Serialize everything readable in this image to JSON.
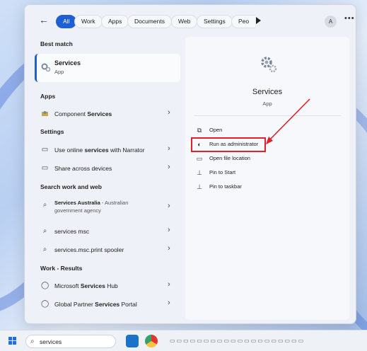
{
  "filters": {
    "back": "←",
    "chips": [
      "All",
      "Work",
      "Apps",
      "Documents",
      "Web",
      "Settings",
      "Peo"
    ],
    "avatar": "A",
    "more": "•••"
  },
  "left": {
    "best_match": {
      "section": "Best match",
      "title": "Services",
      "subtitle": "App"
    },
    "apps": {
      "section": "Apps",
      "items": [
        {
          "pre": "Component ",
          "bold": "Services"
        }
      ]
    },
    "settings": {
      "section": "Settings",
      "items": [
        {
          "pre": "Use online ",
          "bold": "services",
          "post": " with Narrator"
        },
        {
          "pre": "Share across devices"
        }
      ]
    },
    "web": {
      "section": "Search work and web",
      "items": [
        {
          "bold": "Services Australia",
          "post": " - Australian government agency"
        },
        {
          "pre": "services msc"
        },
        {
          "pre": "services.msc.print spooler"
        }
      ]
    },
    "work": {
      "section": "Work - Results",
      "items": [
        {
          "pre": "Microsoft ",
          "bold": "Services",
          "post": " Hub"
        },
        {
          "pre": "Global Partner ",
          "bold": "Services",
          "post": " Portal"
        }
      ]
    }
  },
  "right": {
    "title": "Services",
    "subtitle": "App",
    "actions": [
      {
        "label": "Open",
        "icon": "open-icon"
      },
      {
        "label": "Run as administrator",
        "icon": "shield-icon"
      },
      {
        "label": "Open file location",
        "icon": "folder-icon"
      },
      {
        "label": "Pin to Start",
        "icon": "pin-icon"
      },
      {
        "label": "Pin to taskbar",
        "icon": "pin-icon"
      }
    ],
    "highlight_color": "#e0202a"
  },
  "taskbar": {
    "search_value": "services",
    "accent": "#1f6fe0"
  }
}
